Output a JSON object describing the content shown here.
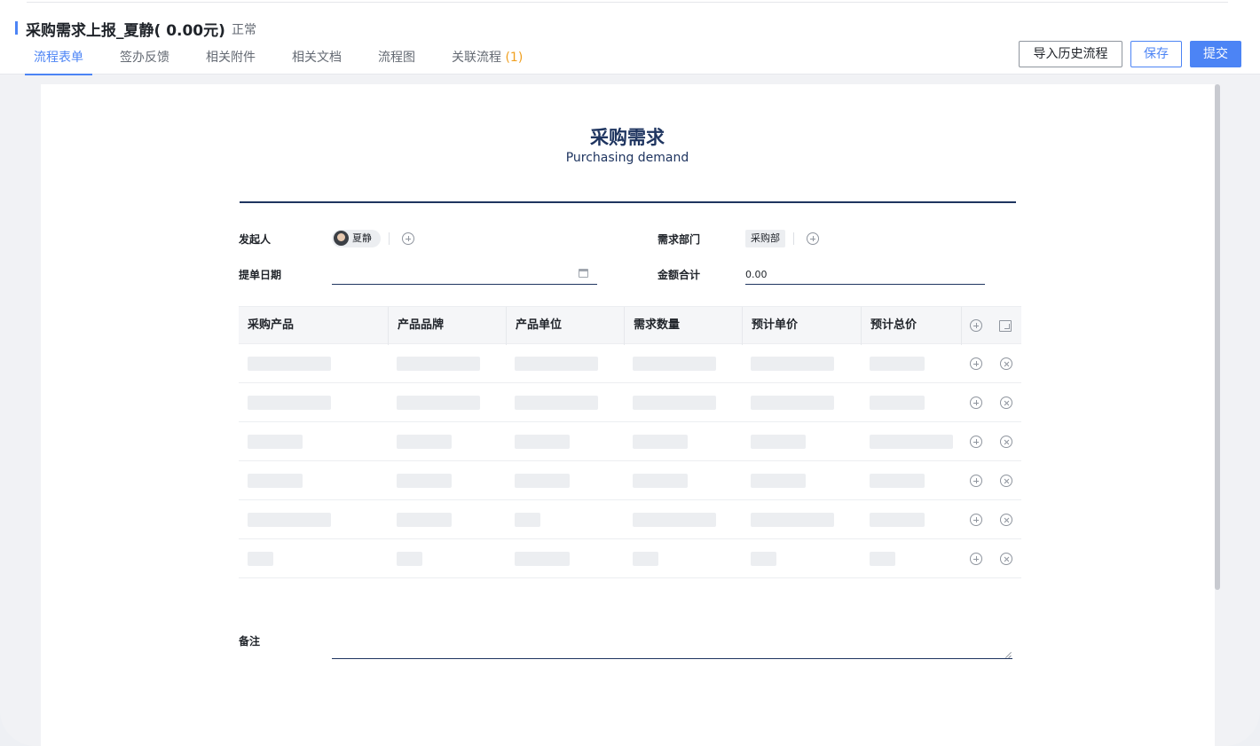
{
  "header": {
    "title": "采购需求上报_夏静( 0.00元)",
    "status": "正常",
    "tabs": [
      {
        "label": "流程表单",
        "active": true
      },
      {
        "label": "签办反馈"
      },
      {
        "label": "相关附件"
      },
      {
        "label": "相关文档"
      },
      {
        "label": "流程图"
      },
      {
        "label": "关联流程",
        "count": "(1)"
      }
    ],
    "buttons": {
      "import": "导入历史流程",
      "save": "保存",
      "submit": "提交"
    }
  },
  "form": {
    "title": "采购需求",
    "subtitle": "Purchasing demand",
    "initiator_label": "发起人",
    "initiator_name": "夏静",
    "department_label": "需求部门",
    "department_value": "采购部",
    "date_label": "提单日期",
    "date_value": "",
    "total_label": "金额合计",
    "total_value": "0.00",
    "remark_label": "备注"
  },
  "table": {
    "columns": [
      "采购产品",
      "产品品牌",
      "产品单位",
      "需求数量",
      "预计单价",
      "预计总价"
    ],
    "row_count": 6
  },
  "colors": {
    "accent": "#4c84f5",
    "form_navy": "#1f3560",
    "count_orange": "#f0a020"
  }
}
